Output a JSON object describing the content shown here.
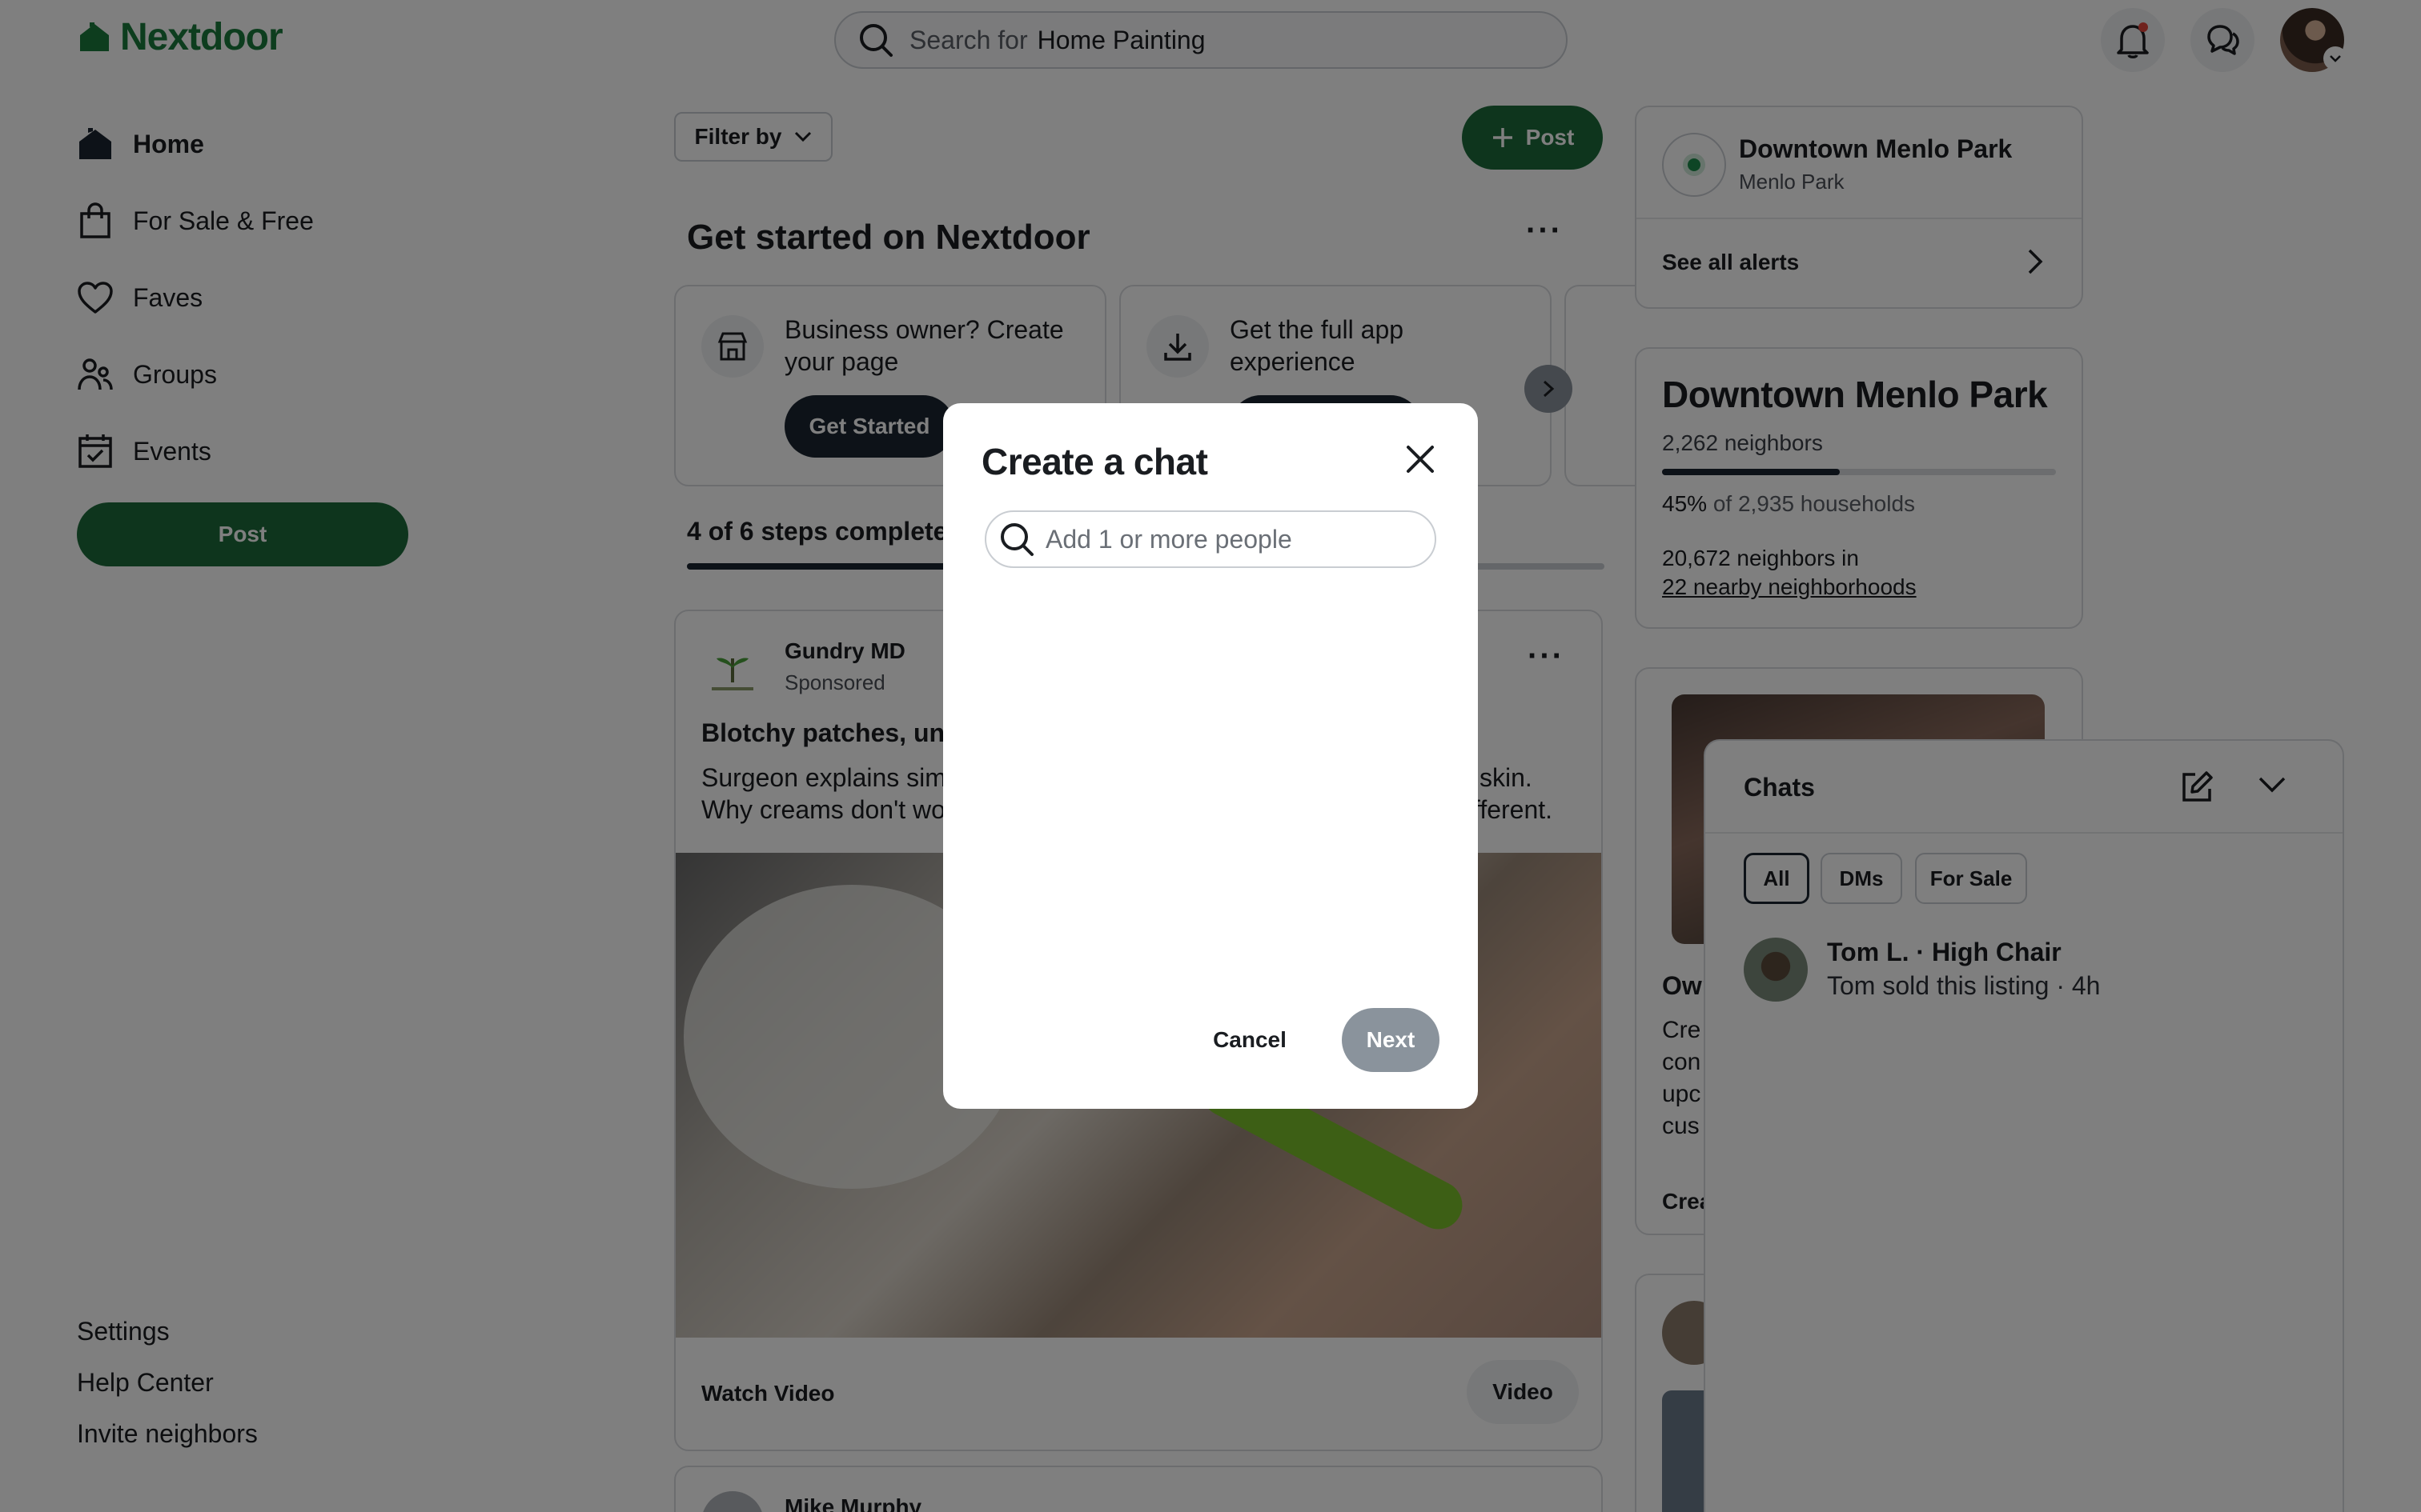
{
  "brand": {
    "name": "Nextdoor",
    "color": "#1a7a3c"
  },
  "top_bar": {
    "search_prefix": "Search for",
    "search_term": "Home Painting"
  },
  "sidebar": {
    "items": [
      {
        "label": "Home",
        "icon": "home-icon",
        "active": true
      },
      {
        "label": "For Sale & Free",
        "icon": "shopping-bag-icon"
      },
      {
        "label": "Faves",
        "icon": "heart-icon"
      },
      {
        "label": "Groups",
        "icon": "groups-icon"
      },
      {
        "label": "Events",
        "icon": "calendar-icon"
      }
    ],
    "post_label": "Post",
    "footer": [
      "Settings",
      "Help Center",
      "Invite neighbors"
    ]
  },
  "feed": {
    "filter_label": "Filter by",
    "post_label": "Post",
    "get_started": {
      "title": "Get started on Nextdoor",
      "cards": [
        {
          "text": "Business owner? Create your page",
          "button": "Get Started"
        },
        {
          "text": "Get the full app experience"
        }
      ],
      "steps_label": "4 of 6 steps completed",
      "steps_done": 4,
      "steps_total": 6
    },
    "sponsored_post": {
      "author": "Gundry MD",
      "meta": "Sponsored",
      "headline": "Blotchy patches, une",
      "body_line1": "Surgeon explains sim",
      "body_line1_end": "skin.",
      "body_line2": "Why creams don't wo",
      "body_line2_end": "fferent.",
      "cta": "Watch Video",
      "badge": "Video"
    },
    "next_post_author": "Mike Murphy"
  },
  "right_column": {
    "alerts": {
      "title": "Downtown Menlo Park",
      "subtitle": "Menlo Park",
      "see_all": "See all alerts"
    },
    "stats": {
      "title": "Downtown Menlo Park",
      "neighbors": "2,262 neighbors",
      "pct": "45%",
      "pct_rest": "of 2,935 households",
      "nearby_1": "20,672 neighbors in",
      "nearby_link": "22 nearby neighborhoods"
    },
    "promo_partial": [
      "Own",
      "Cre",
      "con",
      "upc",
      "cus",
      "Crea"
    ]
  },
  "chats_panel": {
    "title": "Chats",
    "filters": [
      "All",
      "DMs",
      "For Sale"
    ],
    "selected_filter": "All",
    "conversations": [
      {
        "title": "Tom L. · High Chair",
        "preview": "Tom sold this listing · 4h"
      }
    ]
  },
  "modal": {
    "title": "Create a chat",
    "search_placeholder": "Add 1 or more people",
    "cancel_label": "Cancel",
    "next_label": "Next"
  }
}
